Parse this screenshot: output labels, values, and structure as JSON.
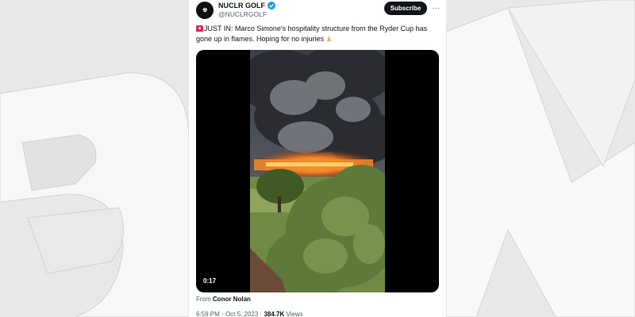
{
  "background": {
    "watermark_text": "BFM"
  },
  "tweet": {
    "display_name": "NUCLR GOLF",
    "handle": "@NUCLRGOLF",
    "subscribe_label": "Subscribe",
    "more_icon": "···",
    "text": "JUST IN: Marco Simone's hospitality structure from the Ryder Cup has gone up in flames. Hoping for no injuries",
    "video_timer": "0:17",
    "from_label": "From",
    "from_name": "Conor Nolan",
    "time": "6:59 PM",
    "sep1": "·",
    "date": "Oct 5, 2023",
    "sep2": "·",
    "views_count": "384.7K",
    "views_label": "Views"
  },
  "icons": {
    "verified": "verified-badge-icon",
    "siren": "siren-emoji-icon",
    "hands": "folded-hands-emoji-icon",
    "more": "more-options-icon"
  },
  "colors": {
    "text": "#0f1419",
    "muted": "#536471",
    "verified_blue": "#1d9bf0",
    "button_bg": "#0f1419",
    "page_bg": "#e9e9e9"
  }
}
